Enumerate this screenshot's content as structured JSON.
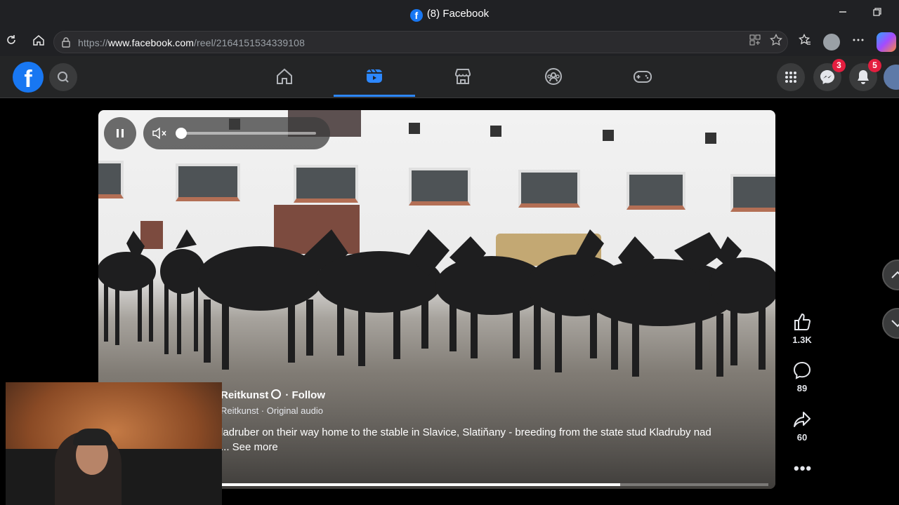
{
  "browser": {
    "tab_title": "(8) Facebook",
    "favicon_letter": "f",
    "url_prefix": "https://",
    "url_host": "www.facebook.com",
    "url_path": "/reel/2164151534339108",
    "window_controls": [
      "minimize-icon",
      "restore-icon"
    ],
    "toolbar_icons": [
      "refresh-icon",
      "home-icon",
      "lock-icon",
      "apps-icon",
      "star-icon",
      "favorites-icon",
      "profile-icon",
      "more-icon",
      "copilot-icon"
    ]
  },
  "facebook": {
    "logo_letter": "f",
    "nav_tabs": [
      "home-icon",
      "reels-icon",
      "marketplace-icon",
      "groups-icon",
      "gaming-icon"
    ],
    "active_tab": "reels-icon",
    "right_buttons": {
      "menu_icon": "grid-icon",
      "messenger_badge": "3",
      "notifications_badge": "5"
    }
  },
  "reel": {
    "author": "Reitkunst",
    "follow_label": "· Follow",
    "audio": "Reitkunst · Original audio",
    "description": "ladruber on their way home to the stable in Slavice, Slatiňany - breeding from the state stud Kladruby nad",
    "see_more": "... See more",
    "progress": 0.73,
    "volume": 0,
    "likes": "1.3K",
    "comments": "89",
    "shares": "60",
    "more_label": "•••"
  },
  "colors": {
    "accent": "#2d88ff",
    "badge": "#e41e3f",
    "fb_blue": "#1877f2"
  }
}
